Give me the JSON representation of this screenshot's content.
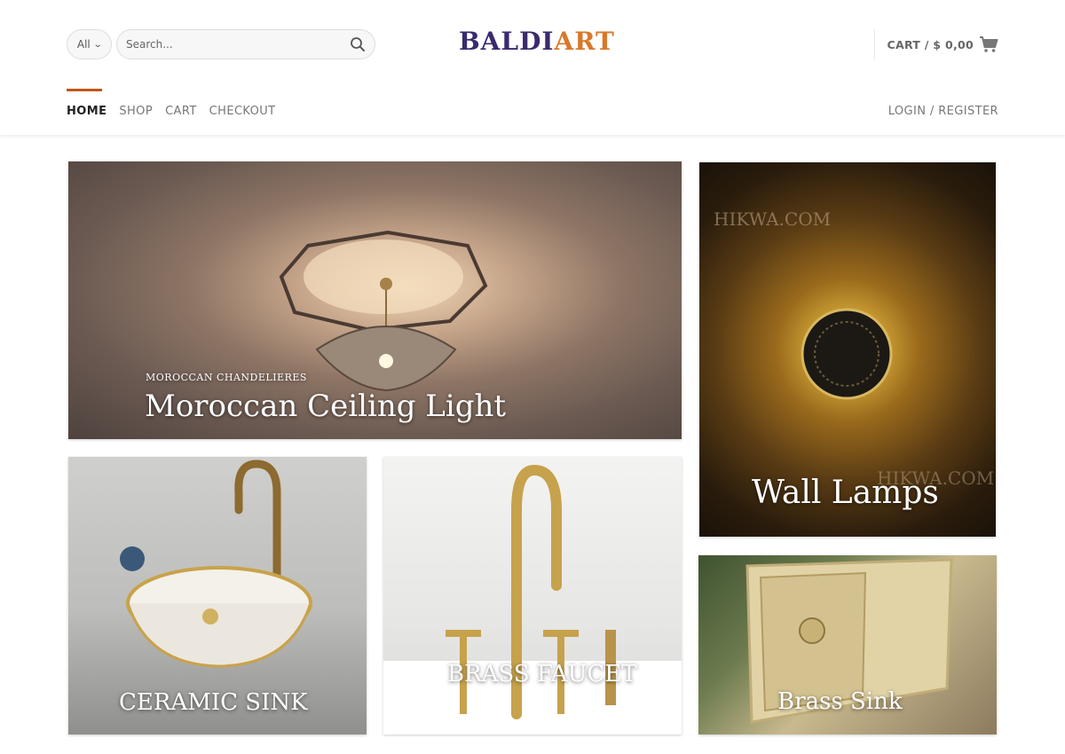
{
  "header": {
    "category_select": {
      "value": "All"
    },
    "search": {
      "placeholder": "Search..."
    },
    "logo": {
      "part1": "BALDI",
      "part2": "ART"
    },
    "cart_label": "CART / $ 0,00",
    "login_label": "LOGIN / REGISTER"
  },
  "nav": {
    "items": [
      {
        "label": "HOME"
      },
      {
        "label": "SHOP"
      },
      {
        "label": "CART"
      },
      {
        "label": "CHECKOUT"
      }
    ]
  },
  "tiles": [
    {
      "title": "Moroccan Ceiling Light",
      "subtitle": "MOROCCAN CHANDELIERES"
    },
    {
      "title": "Wall Lamps",
      "watermark": "HIKWA.COM",
      "watermark2": "HIKWA.COM"
    },
    {
      "title": "CERAMIC SINK"
    },
    {
      "title": "BRASS FAUCET"
    },
    {
      "title": "Brass Sink"
    }
  ],
  "colors": {
    "accent": "#c1561b",
    "logo_primary": "#3a2a6e",
    "logo_secondary": "#d8782a"
  },
  "icons": [
    "chevron-down-icon",
    "search-icon",
    "cart-icon"
  ]
}
